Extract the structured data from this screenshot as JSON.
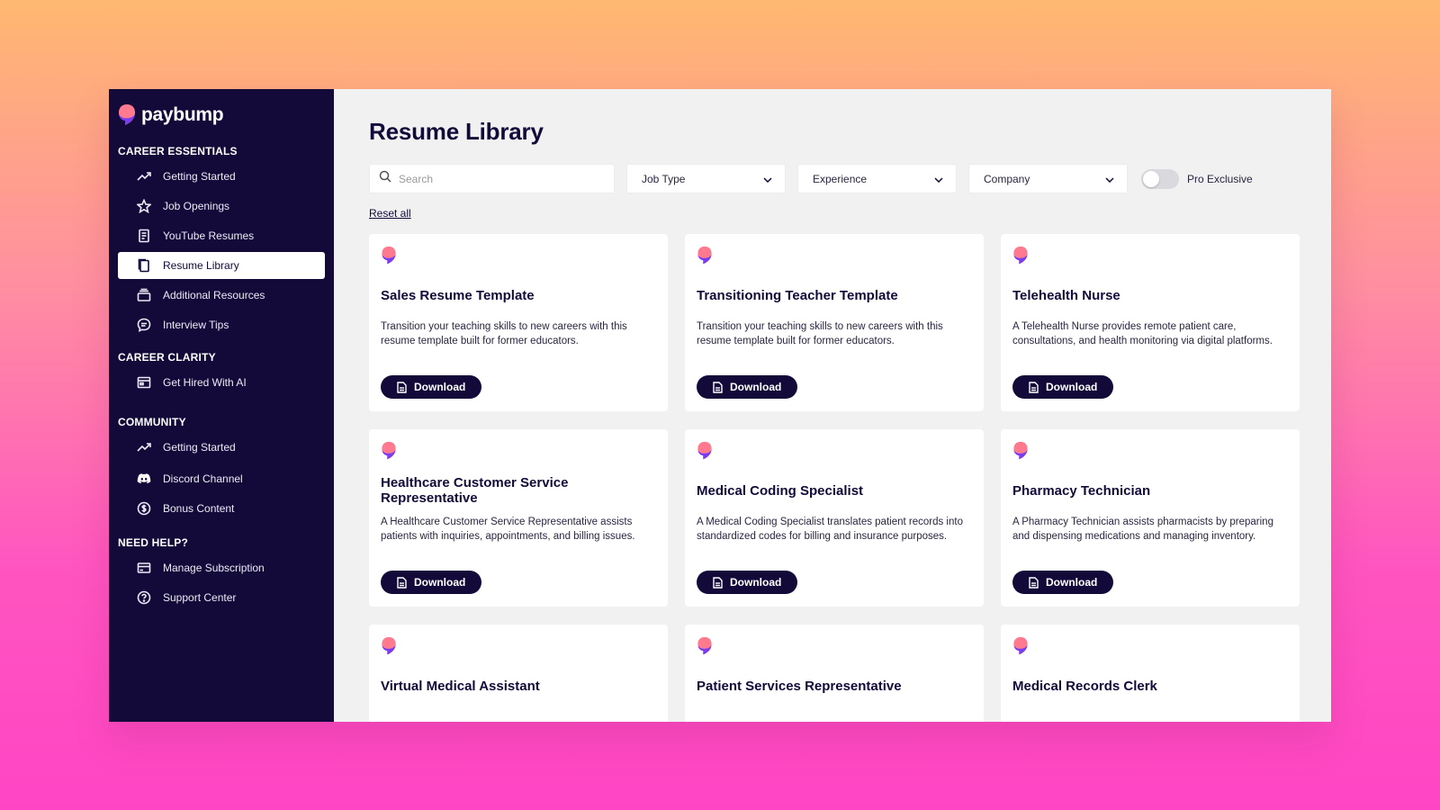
{
  "brand": {
    "name": "paybump"
  },
  "sidebar": {
    "sections": [
      {
        "title": "CAREER ESSENTIALS",
        "items": [
          {
            "label": "Getting Started",
            "icon": "trending-up-icon"
          },
          {
            "label": "Job Openings",
            "icon": "star-icon"
          },
          {
            "label": "YouTube Resumes",
            "icon": "document-icon"
          },
          {
            "label": "Resume Library",
            "icon": "copy-document-icon",
            "active": true
          },
          {
            "label": "Additional Resources",
            "icon": "archive-box-icon"
          },
          {
            "label": "Interview Tips",
            "icon": "chat-bubble-icon"
          }
        ]
      },
      {
        "title": "CAREER CLARITY",
        "items": [
          {
            "label": "Get Hired With AI",
            "icon": "browser-window-icon"
          }
        ]
      },
      {
        "title": "COMMUNITY",
        "items": [
          {
            "label": "Getting Started",
            "icon": "trending-up-icon"
          },
          {
            "label": "Discord Channel",
            "icon": "discord-icon"
          },
          {
            "label": "Bonus Content",
            "icon": "dollar-circle-icon"
          }
        ]
      },
      {
        "title": "NEED HELP?",
        "items": [
          {
            "label": "Manage Subscription",
            "icon": "credit-card-icon"
          },
          {
            "label": "Support Center",
            "icon": "help-circle-icon"
          }
        ]
      }
    ]
  },
  "main": {
    "title": "Resume Library",
    "search": {
      "placeholder": "Search",
      "value": ""
    },
    "filters": {
      "job_type": "Job Type",
      "experience": "Experience",
      "company": "Company"
    },
    "pro_exclusive": {
      "label": "Pro Exclusive",
      "on": false
    },
    "reset_label": "Reset all",
    "download_label": "Download",
    "cards": [
      {
        "title": "Sales Resume Template",
        "description": "Transition your teaching skills to new careers with this resume template built for former educators."
      },
      {
        "title": "Transitioning Teacher Template",
        "description": "Transition your teaching skills to new careers with this resume template built for former educators."
      },
      {
        "title": "Telehealth Nurse",
        "description": "A Telehealth Nurse provides remote patient care, consultations, and health monitoring via digital platforms."
      },
      {
        "title": "Healthcare Customer Service Representative",
        "description": "A Healthcare Customer Service Representative assists patients with inquiries, appointments, and billing issues."
      },
      {
        "title": "Medical Coding Specialist",
        "description": "A Medical Coding Specialist translates patient records into standardized codes for billing and insurance purposes."
      },
      {
        "title": "Pharmacy Technician",
        "description": "A Pharmacy Technician assists pharmacists by preparing and dispensing medications and managing inventory."
      },
      {
        "title": "Virtual Medical Assistant",
        "description": ""
      },
      {
        "title": "Patient Services Representative",
        "description": ""
      },
      {
        "title": "Medical Records Clerk",
        "description": ""
      }
    ]
  },
  "colors": {
    "sidebar_bg": "#130a3a",
    "accent_navy": "#130a3a",
    "logo_pink": "#ff6a8c",
    "logo_purple": "#7a3cf0",
    "page_bg": "#f1f1f1"
  }
}
